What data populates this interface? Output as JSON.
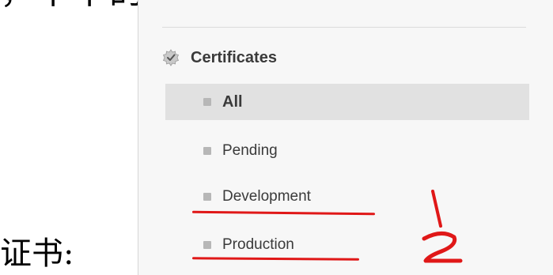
{
  "caption": {
    "top_line": "，下下的选契件选微件的微件以为机",
    "label": "证书:"
  },
  "sidebar": {
    "section": {
      "title": "Certificates",
      "icon": "certificate-icon"
    },
    "items": [
      {
        "label": "All",
        "active": true
      },
      {
        "label": "Pending",
        "active": false
      },
      {
        "label": "Development",
        "active": false
      },
      {
        "label": "Production",
        "active": false
      }
    ]
  },
  "annotations": {
    "numbers": [
      "1",
      "2"
    ],
    "underline_color": "#e01818"
  }
}
